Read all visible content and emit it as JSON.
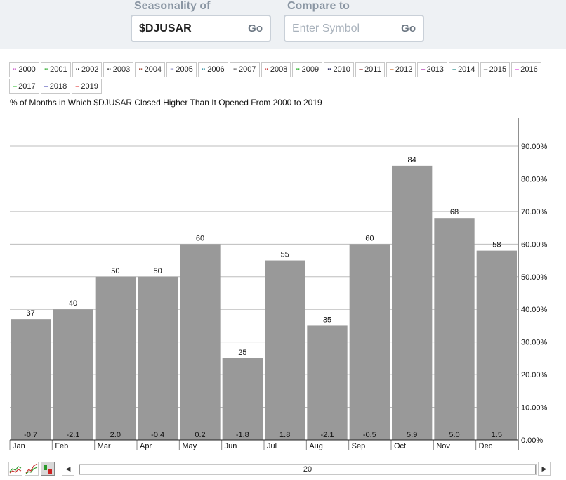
{
  "search": {
    "seasonality_label": "Seasonality of",
    "seasonality_value": "$DJUSAR",
    "go_label": "Go",
    "compare_label": "Compare to",
    "compare_placeholder": "Enter Symbol",
    "compare_go_label": "Go"
  },
  "legend": [
    {
      "label": "2000",
      "color": "#d070d0",
      "dash": ":"
    },
    {
      "label": "2001",
      "color": "#55bb55",
      "dash": ":"
    },
    {
      "label": "2002",
      "color": "#333333",
      "dash": ":"
    },
    {
      "label": "2003",
      "color": "#333333",
      "dash": ":"
    },
    {
      "label": "2004",
      "color": "#aa5544",
      "dash": ":"
    },
    {
      "label": "2005",
      "color": "#5555aa",
      "dash": ":"
    },
    {
      "label": "2006",
      "color": "#4499aa",
      "dash": ":"
    },
    {
      "label": "2007",
      "color": "#888888",
      "dash": ":"
    },
    {
      "label": "2008",
      "color": "#cc4444",
      "dash": ":"
    },
    {
      "label": "2009",
      "color": "#44bb44",
      "dash": ":"
    },
    {
      "label": "2010",
      "color": "#333366",
      "dash": ":"
    },
    {
      "label": "2011",
      "color": "#882222",
      "dash": "–"
    },
    {
      "label": "2012",
      "color": "#cc6622",
      "dash": "–"
    },
    {
      "label": "2013",
      "color": "#aa22aa",
      "dash": "–"
    },
    {
      "label": "2014",
      "color": "#228888",
      "dash": "–"
    },
    {
      "label": "2015",
      "color": "#888888",
      "dash": "–"
    },
    {
      "label": "2016",
      "color": "#dd44dd",
      "dash": "–"
    },
    {
      "label": "2017",
      "color": "#22bb22",
      "dash": "–"
    },
    {
      "label": "2018",
      "color": "#3333aa",
      "dash": "–"
    },
    {
      "label": "2019",
      "color": "#dd2222",
      "dash": "–"
    }
  ],
  "chart_data": {
    "type": "bar",
    "title": "% of Months in Which $DJUSAR Closed Higher Than It Opened From 2000 to 2019",
    "categories": [
      "Jan",
      "Feb",
      "Mar",
      "Apr",
      "May",
      "Jun",
      "Jul",
      "Aug",
      "Sep",
      "Oct",
      "Nov",
      "Dec"
    ],
    "values": [
      37,
      40,
      50,
      50,
      60,
      25,
      55,
      35,
      60,
      84,
      68,
      58
    ],
    "avg_returns": [
      "-0.7",
      "-2.1",
      "2.0",
      "-0.4",
      "0.2",
      "-1.8",
      "1.8",
      "-2.1",
      "-0.5",
      "5.9",
      "5.0",
      "1.5"
    ],
    "ylim": [
      0,
      90
    ],
    "yticks": [
      "0.00%",
      "10.00%",
      "20.00%",
      "30.00%",
      "40.00%",
      "50.00%",
      "60.00%",
      "70.00%",
      "80.00%",
      "90.00%"
    ],
    "grid": true,
    "bar_color": "#999999"
  },
  "footer": {
    "scroll_left": "◀",
    "scroll_right": "▶",
    "range_value": "20"
  }
}
